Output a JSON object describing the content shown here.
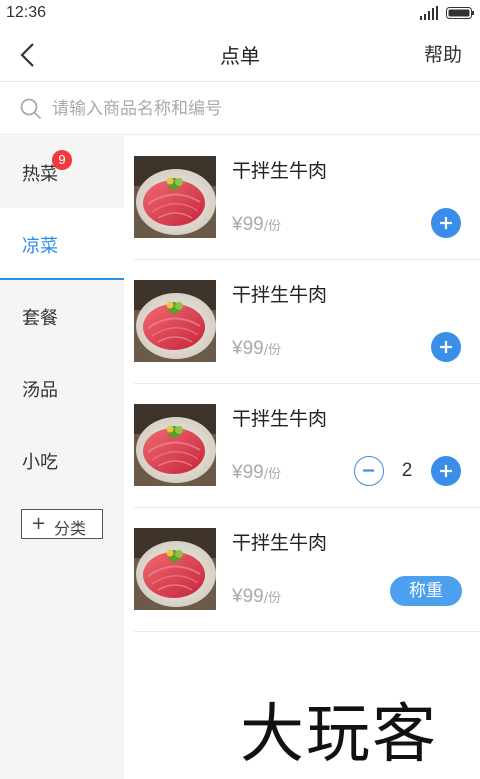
{
  "status_bar": {
    "time": "12:36"
  },
  "nav": {
    "title": "点单",
    "help_label": "帮助"
  },
  "search": {
    "placeholder": "请输入商品名称和编号"
  },
  "sidebar": {
    "items": [
      {
        "label": "热菜",
        "badge": "9"
      },
      {
        "label": "凉菜",
        "active": true
      },
      {
        "label": "套餐"
      },
      {
        "label": "汤品"
      },
      {
        "label": "小吃"
      }
    ],
    "add_category_label": "分类"
  },
  "menu_items": [
    {
      "name": "干拌生牛肉",
      "price": "¥99",
      "unit": "/份",
      "control": "add"
    },
    {
      "name": "干拌生牛肉",
      "price": "¥99",
      "unit": "/份",
      "control": "add"
    },
    {
      "name": "干拌生牛肉",
      "price": "¥99",
      "unit": "/份",
      "control": "stepper",
      "quantity": "2"
    },
    {
      "name": "干拌生牛肉",
      "price": "¥99",
      "unit": "/份",
      "control": "weigh",
      "weigh_label": "称重"
    }
  ],
  "watermark": "大玩客",
  "colors": {
    "accent": "#3a8ee8",
    "badge": "#f0393a",
    "sidebar_bg": "#f5f5f5",
    "price": "#aaaaaa"
  }
}
